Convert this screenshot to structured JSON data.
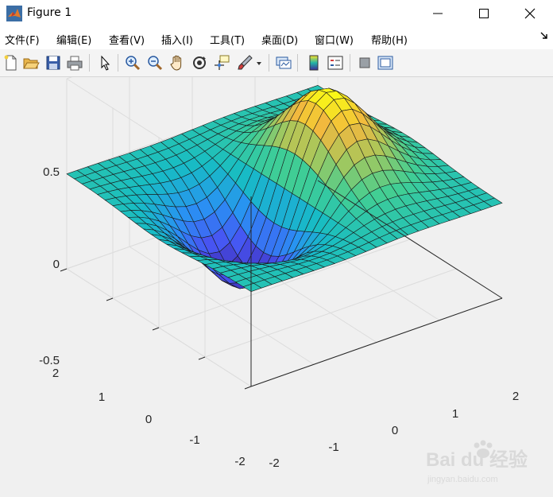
{
  "window": {
    "title": "Figure 1"
  },
  "menu": {
    "items": [
      {
        "label": "文件(F)"
      },
      {
        "label": "编辑(E)"
      },
      {
        "label": "查看(V)"
      },
      {
        "label": "插入(I)"
      },
      {
        "label": "工具(T)"
      },
      {
        "label": "桌面(D)"
      },
      {
        "label": "窗口(W)"
      },
      {
        "label": "帮助(H)"
      }
    ]
  },
  "toolbar": {
    "buttons": [
      "new-figure-icon",
      "open-icon",
      "save-icon",
      "print-icon",
      "select-arrow-icon",
      "zoom-in-icon",
      "zoom-out-icon",
      "pan-hand-icon",
      "rotate-3d-icon",
      "data-cursor-icon",
      "brush-icon",
      "link-plot-icon",
      "colorbar-icon",
      "legend-icon",
      "hide-plot-tools-icon",
      "show-plot-tools-icon"
    ]
  },
  "chart_data": {
    "type": "surface",
    "function": "z = x*exp(-x^2 - y^2)",
    "xlim": [
      -2,
      2
    ],
    "ylim": [
      -2,
      2
    ],
    "zlim": [
      -0.5,
      0.5
    ],
    "x_ticks": [
      "-2",
      "0",
      "2"
    ],
    "y_ticks": [
      "-2",
      "-1",
      "0",
      "1",
      "2"
    ],
    "z_ticks": [
      "-0.5",
      "0",
      "0.5"
    ],
    "grid": true,
    "colormap": "parula",
    "grid_points": 25
  },
  "watermark": {
    "text": "Bai du 经验",
    "sub": "jingyan.baidu.com"
  }
}
